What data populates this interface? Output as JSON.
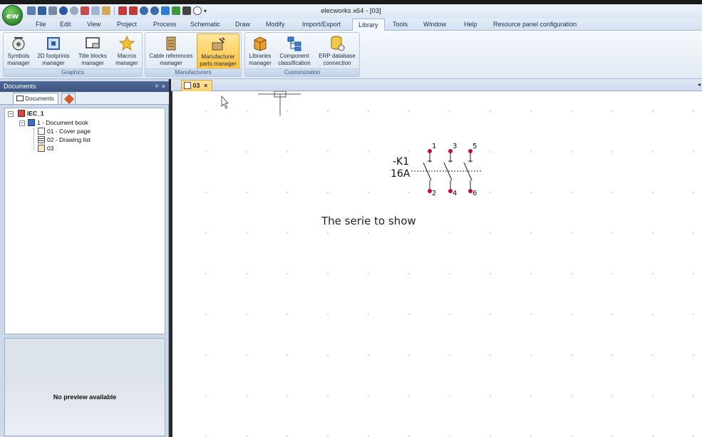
{
  "app": {
    "title": "elecworks x64 - [03]",
    "logo_text": "ew"
  },
  "quick_access": [
    "new-icon",
    "save-icon",
    "print-icon",
    "undo-icon",
    "redo-icon",
    "cut-icon",
    "copy-icon",
    "paste-icon",
    "insert-left-icon",
    "insert-right-icon",
    "zoom-icon",
    "zoom-out-icon",
    "pan-icon",
    "refresh-icon",
    "binoculars-icon",
    "help-icon",
    "customize-dropdown-icon"
  ],
  "menu": {
    "items": [
      "File",
      "Edit",
      "View",
      "Project",
      "Process",
      "Schematic",
      "Draw",
      "Modify",
      "Import/Export",
      "Library",
      "Tools",
      "Window",
      "Help",
      "Resource panel configuration"
    ],
    "active": "Library"
  },
  "ribbon": {
    "groups": [
      {
        "label": "Graphics",
        "buttons": [
          {
            "line1": "Symbols",
            "line2": "manager"
          },
          {
            "line1": "2D footprints",
            "line2": "manager"
          },
          {
            "line1": "Title blocks",
            "line2": "manager"
          },
          {
            "line1": "Macros",
            "line2": "manager"
          }
        ]
      },
      {
        "label": "Manufacturers",
        "buttons": [
          {
            "line1": "Cable references",
            "line2": "manager"
          },
          {
            "line1": "Manufacturer",
            "line2": "parts manager"
          }
        ]
      },
      {
        "label": "Customization",
        "buttons": [
          {
            "line1": "Libraries",
            "line2": "manager"
          },
          {
            "line1": "Component",
            "line2": "classification"
          },
          {
            "line1": "ERP database",
            "line2": "connection"
          }
        ]
      }
    ]
  },
  "panel": {
    "title": "Documents",
    "pin": "ᵖ",
    "close": "×",
    "tabs": {
      "documents": "Documents"
    },
    "tree": {
      "root": "IEC_1",
      "book": "1 - Document book",
      "items": [
        "01 - Cover page",
        "02 - Drawing list",
        "03"
      ]
    },
    "preview_text": "No preview available"
  },
  "document_tab": {
    "label": "03",
    "close": "×"
  },
  "drawing": {
    "tag": "-K1",
    "rating": "16A",
    "pins_top": [
      "1",
      "3",
      "5"
    ],
    "pins_bottom": [
      "2",
      "4",
      "6"
    ],
    "note": "The serie to show"
  },
  "colors": {
    "accent": "#ffc33d",
    "panel_header": "#3b5683",
    "pin_dot": "#c8102e"
  }
}
